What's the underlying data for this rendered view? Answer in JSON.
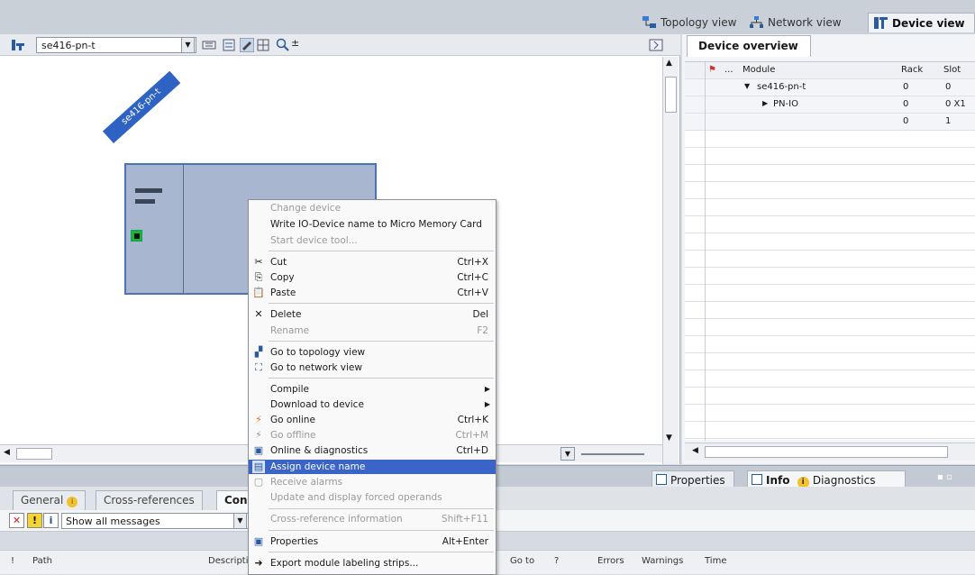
{
  "views": {
    "topology": "Topology view",
    "network": "Network view",
    "device": "Device view"
  },
  "editor": {
    "device_select": "se416-pn-t",
    "device_label": "se416-pn-t"
  },
  "device_overview": {
    "tab": "Device overview",
    "columns": {
      "module": "Module",
      "dots": "...",
      "rack": "Rack",
      "slot": "Slot"
    },
    "rows": [
      {
        "module": "se416-pn-t",
        "rack": "0",
        "slot": "0"
      },
      {
        "module": "PN-IO",
        "rack": "0",
        "slot": "0 X1"
      },
      {
        "module": "",
        "rack": "0",
        "slot": "1"
      }
    ]
  },
  "context_menu": {
    "items": [
      {
        "label": "Change device",
        "shortcut": ""
      },
      {
        "label": "Write IO-Device name to Micro Memory Card",
        "shortcut": ""
      },
      {
        "label": "Start device tool...",
        "shortcut": ""
      },
      {
        "label": "Cut",
        "shortcut": "Ctrl+X"
      },
      {
        "label": "Copy",
        "shortcut": "Ctrl+C"
      },
      {
        "label": "Paste",
        "shortcut": "Ctrl+V"
      },
      {
        "label": "Delete",
        "shortcut": "Del"
      },
      {
        "label": "Rename",
        "shortcut": "F2"
      },
      {
        "label": "Go to topology view",
        "shortcut": ""
      },
      {
        "label": "Go to network view",
        "shortcut": ""
      },
      {
        "label": "Compile",
        "shortcut": ""
      },
      {
        "label": "Download to device",
        "shortcut": ""
      },
      {
        "label": "Go online",
        "shortcut": "Ctrl+K"
      },
      {
        "label": "Go offline",
        "shortcut": "Ctrl+M"
      },
      {
        "label": "Online & diagnostics",
        "shortcut": "Ctrl+D"
      },
      {
        "label": "Assign device name",
        "shortcut": ""
      },
      {
        "label": "Receive alarms",
        "shortcut": ""
      },
      {
        "label": "Update and display forced operands",
        "shortcut": ""
      },
      {
        "label": "Cross-reference information",
        "shortcut": "Shift+F11"
      },
      {
        "label": "Properties",
        "shortcut": "Alt+Enter"
      },
      {
        "label": "Export module labeling strips...",
        "shortcut": ""
      }
    ]
  },
  "inspector": {
    "properties": "Properties",
    "info": "Info",
    "diagnostics": "Diagnostics"
  },
  "bottom_tabs": {
    "general": "General",
    "cross_references": "Cross-references",
    "compile": "Con"
  },
  "messages": {
    "filter": "Show all messages"
  },
  "columns": {
    "bang": "!",
    "path": "Path",
    "description": "Descripti",
    "goto": "Go to",
    "q": "?",
    "errors": "Errors",
    "warnings": "Warnings",
    "time": "Time"
  },
  "colors": {
    "highlight": "#3a64c8",
    "device_fill": "#a8b6cf"
  }
}
